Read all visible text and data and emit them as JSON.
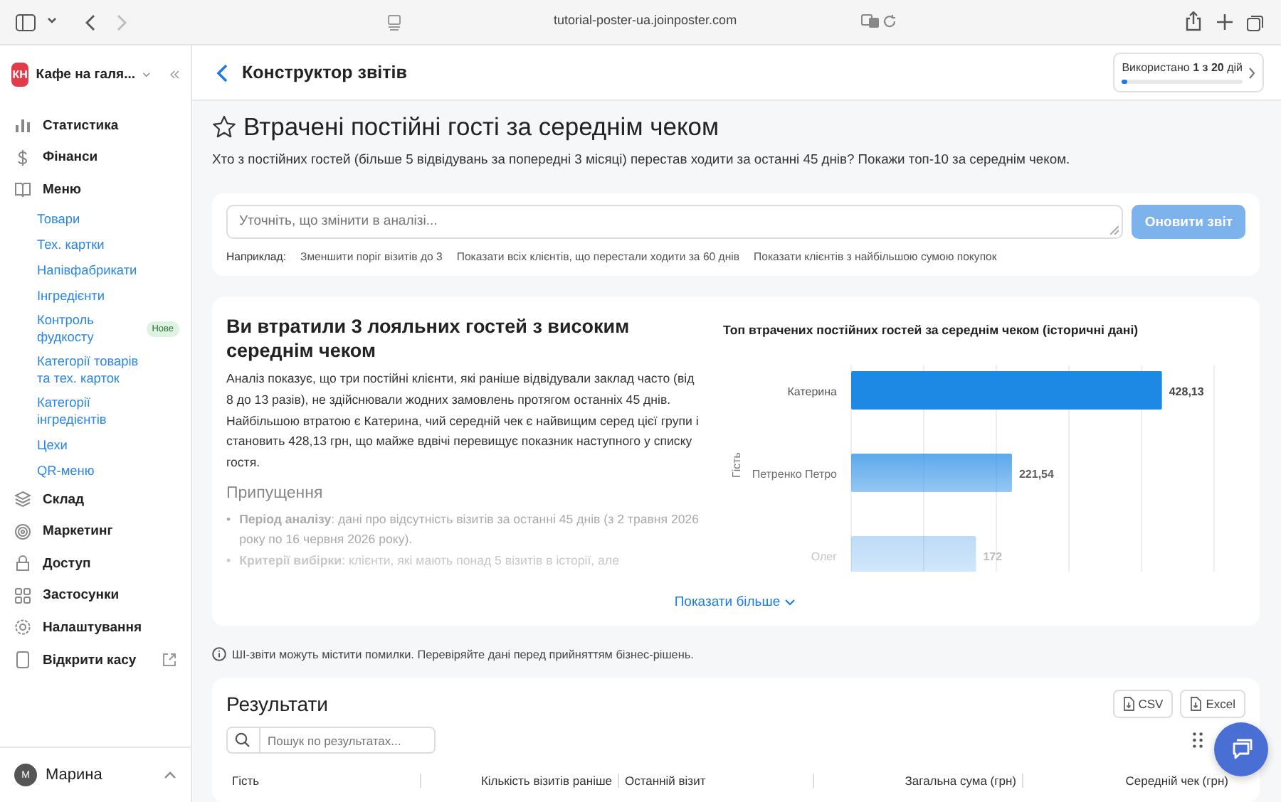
{
  "browser": {
    "url": "tutorial-poster-ua.joinposter.com"
  },
  "sidebar": {
    "org_initials": "КН",
    "org_name": "Кафе на галя...",
    "items": [
      {
        "label": "Статистика"
      },
      {
        "label": "Фінанси"
      },
      {
        "label": "Меню",
        "children": [
          {
            "label": "Товари"
          },
          {
            "label": "Тех. картки"
          },
          {
            "label": "Напівфабрикати"
          },
          {
            "label": "Інгредієнти"
          },
          {
            "label": "Контроль фудкосту",
            "badge": "Нове"
          },
          {
            "label": "Категорії товарів та тех. карток"
          },
          {
            "label": "Категорії інгредієнтів"
          },
          {
            "label": "Цехи"
          },
          {
            "label": "QR-меню"
          }
        ]
      },
      {
        "label": "Склад"
      },
      {
        "label": "Маркетинг"
      },
      {
        "label": "Доступ"
      },
      {
        "label": "Застосунки"
      },
      {
        "label": "Налаштування"
      },
      {
        "label": "Відкрити касу",
        "external": true
      }
    ],
    "user": {
      "initial": "М",
      "name": "Марина"
    }
  },
  "header": {
    "title": "Конструктор звітів",
    "usage": {
      "text": "Використано **1 з 20** дій",
      "level": 0.05
    }
  },
  "report": {
    "title": "Втрачені постійні гості за середнім чеком",
    "starred": false,
    "question": "Хто з постійних гостей (більше 5 відвідувань за попередні 3 місяці) перестав ходити за останні 45 днів? Покажи топ-10 за середнім чеком."
  },
  "refine": {
    "placeholder": "Уточніть, що змінити в аналізі...",
    "button": "Оновити звіт",
    "examples_label": "Наприклад:",
    "examples": [
      "Зменшити поріг візитів до 3",
      "Показати всіх клієнтів, що перестали ходити за 60 днів",
      "Показати клієнтів з найбільшою сумою покупок"
    ]
  },
  "analysis": {
    "title": "Ви втратили 3 лояльних гостей з високим середнім чеком",
    "text": "Аналіз показує, що три постійні клієнти, які раніше відвідували заклад часто (від 8 до 13 разів), не здійснювали жодних замовлень протягом останніх 45 днів. Найбільшою втратою є Катерина, чий середній чек є найвищим серед цієї групи і становить 428,13 грн, що майже вдвічі перевищує показник наступного у списку гостя.",
    "assumptions_title": "Припущення",
    "assumptions": [
      {
        "bullet": "•",
        "text": "**Період аналізу**: дані про відсутність візитів за останні 45 днів (з 2 травня 2026 року по 16 червня 2026 року)."
      },
      {
        "bullet": "•",
        "text": "**Критерії вибірки**: клієнти, які мають понад 5 візитів в історії, але"
      }
    ],
    "show_more": "Показати більше",
    "chart_data": {
      "type": "bar",
      "orientation": "horizontal",
      "title": "Топ втрачених постійних гостей за середнім чеком (історичні дані)",
      "ylabel": "Гість",
      "categories": [
        "Катерина",
        "Петренко Петро",
        "Олег"
      ],
      "values": [
        428.13,
        221.54,
        172
      ],
      "value_labels": [
        "428,13",
        "221,54",
        "172"
      ],
      "data_labels": true
    }
  },
  "disclaimer": "ШІ-звіти можуть містити помилки. Перевіряйте дані перед прийняттям бізнес-рішень.",
  "results": {
    "title": "Результати",
    "exports": [
      "CSV",
      "Excel"
    ],
    "search_placeholder": "Пошук по результатах...",
    "columns": [
      "Гість",
      "Кількість візитів раніше",
      "Останній візит",
      "Загальна сума (грн)",
      "Середній чек (грн)"
    ]
  }
}
